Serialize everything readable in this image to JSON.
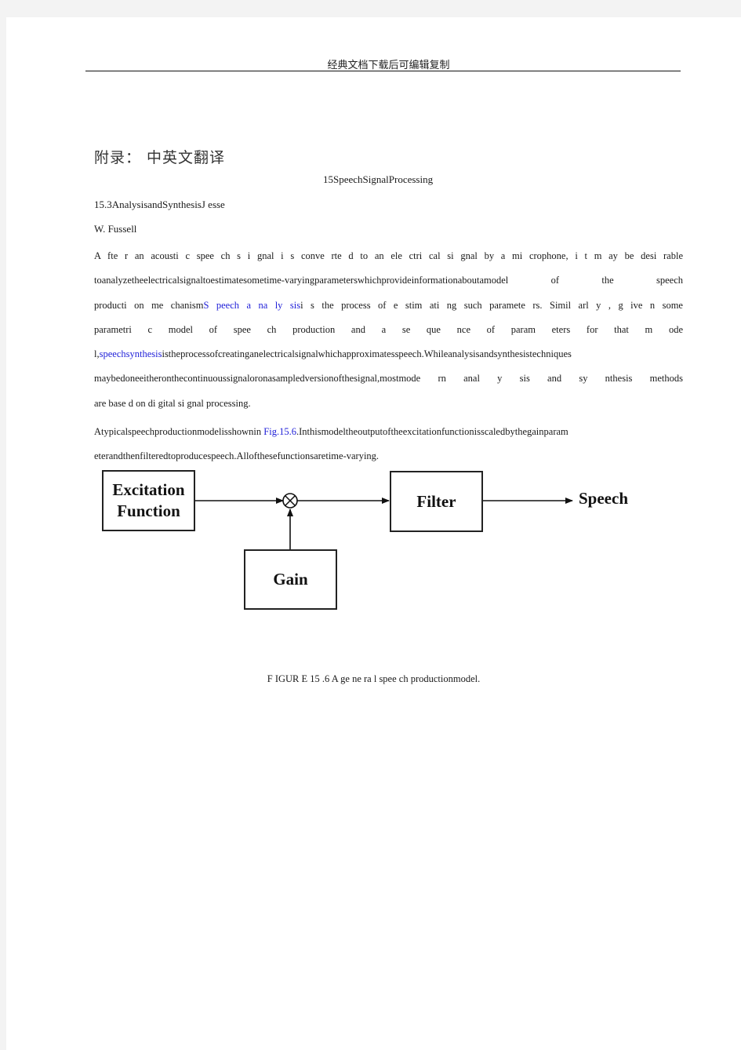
{
  "header": {
    "text": "经典文档下载后可编辑复制"
  },
  "document": {
    "appendix_title": "附录：  中英文翻译",
    "chapter_title": "15SpeechSignalProcessing",
    "section_title": "15.3AnalysisandSynthesisJ  esse",
    "author": "W.  Fussell",
    "paragraph1": {
      "lines": [
        {
          "parts": [
            {
              "text": "A fte r an acousti c spee ch s i gnal i s conve rte d to an ele ctri cal si gnal by a mi crophone, i t m ay be desi rable",
              "link": false
            }
          ]
        },
        {
          "parts": [
            {
              "text": "toanalyzetheelectricalsignaltoestimatesometime-varyingparameterswhichprovideinformationaboutamodel  of  the    speech",
              "link": false
            }
          ]
        },
        {
          "parts": [
            {
              "text": "producti  on  me  chanism",
              "link": false
            },
            {
              "text": "S peech  a  na  ly  sis",
              "link": true
            },
            {
              "text": "i  s  the process  of  e  stim  ati  ng  such  paramete  rs.  Simil  arl  y  ,  g  ive  n  some",
              "link": false
            }
          ]
        },
        {
          "parts": [
            {
              "text": "parametri  c  model  of  spee  ch  production  and  a  se  que  nce  of  param  eters  for  that  m  ode",
              "link": false
            }
          ]
        },
        {
          "parts": [
            {
              "text": "l,",
              "link": false
            },
            {
              "text": "speechsynthesis",
              "link": true
            },
            {
              "text": "istheprocessofcreatinganelectricalsignalwhichapproximatesspeech.Whileanalysisandsynthesistechniques",
              "link": false
            }
          ]
        },
        {
          "parts": [
            {
              "text": "maybedoneeitheronthecontinuoussignaloronasampledversionofthesignal,mostmode  rn  anal  y  sis  and  sy  nthesis  methods",
              "link": false
            }
          ]
        },
        {
          "parts": [
            {
              "text": "are  base  d    on  di  gital  si  gnal  processing.",
              "link": false
            }
          ]
        }
      ]
    },
    "paragraph2": {
      "lines": [
        {
          "parts": [
            {
              "text": "Atypicalspeechproductionmodelisshownin ",
              "link": false
            },
            {
              "text": "Fig.15.6",
              "link": true
            },
            {
              "text": ".Inthismodeltheoutputoftheexcitationfunctionisscaledbythegainparam",
              "link": false
            }
          ]
        },
        {
          "parts": [
            {
              "text": "eterandthenfilteredtoproducespeech.Allofthesefunctionsaretime-varying.",
              "link": false
            }
          ]
        }
      ]
    },
    "figure": {
      "blocks": {
        "excitation": [
          "Excitation",
          "Function"
        ],
        "gain": "Gain",
        "filter": "Filter"
      },
      "output_label": "Speech",
      "multiplier_symbol": "multiply-circle"
    },
    "caption": "F  IGUR  E    15  .6  A  ge  ne  ra  l  spee  ch  productionmodel."
  }
}
